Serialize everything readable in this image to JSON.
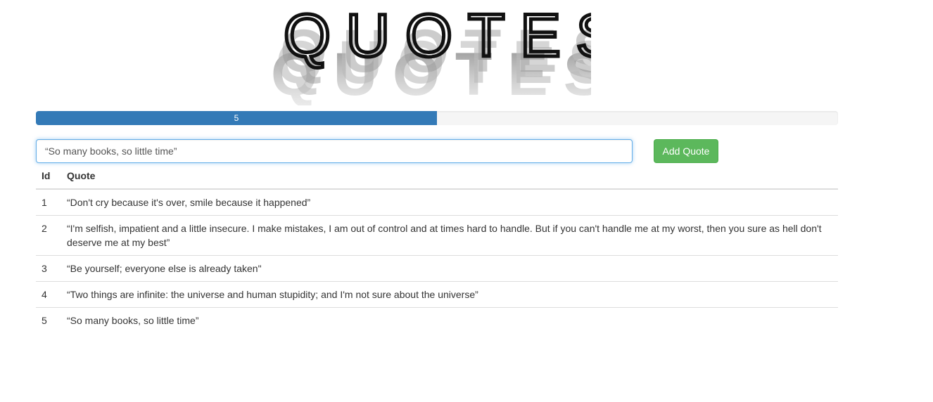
{
  "logo": {
    "text": "QUOTES"
  },
  "progress": {
    "label": "5",
    "fraction": 0.5
  },
  "input": {
    "value": "“So many books, so little time”"
  },
  "add_button": {
    "label": "Add Quote"
  },
  "table": {
    "headers": {
      "id": "Id",
      "quote": "Quote"
    },
    "rows": [
      {
        "id": "1",
        "quote": "“Don't cry because it's over, smile because it happened”"
      },
      {
        "id": "2",
        "quote": "“I'm selfish, impatient and a little insecure. I make mistakes, I am out of control and at times hard to handle. But if you can't handle me at my worst, then you sure as hell don't deserve me at my best”"
      },
      {
        "id": "3",
        "quote": "“Be yourself; everyone else is already taken\""
      },
      {
        "id": "4",
        "quote": "“Two things are infinite: the universe and human stupidity; and I'm not sure about the universe”"
      },
      {
        "id": "5",
        "quote": "“So many books, so little time”"
      }
    ]
  }
}
